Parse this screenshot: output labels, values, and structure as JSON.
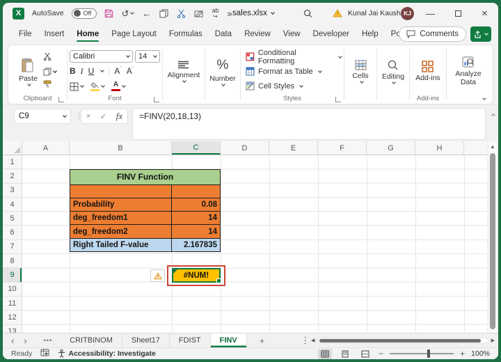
{
  "title_bar": {
    "autosave_label": "AutoSave",
    "autosave_state": "Off",
    "file_name": "sales.xlsx",
    "user_name": "Kunal Jai Kaushik",
    "user_initials": "KJ"
  },
  "menu": {
    "tabs": [
      "File",
      "Insert",
      "Home",
      "Page Layout",
      "Formulas",
      "Data",
      "Review",
      "View",
      "Developer",
      "Help",
      "Power Pivot"
    ],
    "comments_label": "Comments"
  },
  "ribbon": {
    "paste_label": "Paste",
    "clipboard_group": "Clipboard",
    "font_group": "Font",
    "font_name": "Calibri",
    "font_size": "14",
    "bold": "B",
    "italic": "I",
    "underline": "U",
    "grow_font": "A",
    "shrink_font": "A",
    "font_color_letter": "A",
    "percent_symbol": "%",
    "alignment_label": "Alignment",
    "number_label": "Number",
    "conditional_formatting": "Conditional Formatting",
    "format_as_table": "Format as Table",
    "cell_styles": "Cell Styles",
    "styles_group": "Styles",
    "cells_label": "Cells",
    "editing_label": "Editing",
    "addins_label": "Add-ins",
    "addins_group": "Add-ins",
    "analyze_data_label": "Analyze Data"
  },
  "formula_bar": {
    "name_box": "C9",
    "fx_label": "fx",
    "formula": "=FINV(20,18,13)"
  },
  "grid": {
    "columns": [
      "A",
      "B",
      "C",
      "D",
      "E",
      "F",
      "G",
      "H"
    ],
    "rows": [
      "1",
      "2",
      "3",
      "4",
      "5",
      "6",
      "7",
      "8",
      "9",
      "10",
      "11",
      "12",
      "13"
    ],
    "selected_cell": "C9",
    "table": {
      "title": "FINV Function",
      "rows": [
        {
          "label": "Probability",
          "value": "0.08"
        },
        {
          "label": "deg_freedom1",
          "value": "14"
        },
        {
          "label": "deg_freedom2",
          "value": "14"
        },
        {
          "label": "Right Tailed F-value",
          "value": "2.167835"
        }
      ]
    },
    "error_value": "#NUM!"
  },
  "sheets": {
    "tabs": [
      "CRITBINOM",
      "Sheet17",
      "FDIST",
      "FINV"
    ],
    "active": "FINV"
  },
  "status_bar": {
    "ready": "Ready",
    "accessibility": "Accessibility: Investigate",
    "zoom": "100%"
  },
  "colors": {
    "accent_green": "#107C41",
    "table_orange": "#ED7D31",
    "table_header_green": "#A9D08E",
    "result_blue": "#BDD7EE",
    "error_fill_yellow": "#FFC000",
    "error_outline_red": "#CB4335"
  }
}
